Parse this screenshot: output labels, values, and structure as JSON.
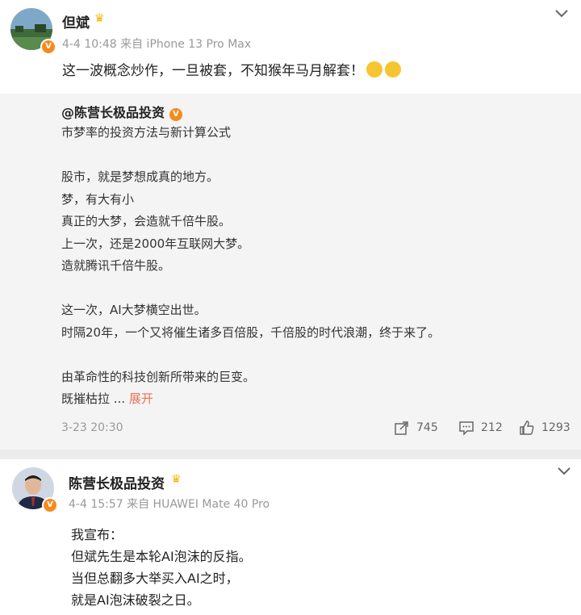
{
  "post1": {
    "author": "但斌",
    "meta": "4-4 10:48  来自 iPhone 13 Pro Max",
    "text": "这一波概念炒作，一旦被套，不知猴年马月解套！"
  },
  "repost": {
    "author": "@陈营长极品投资",
    "lines": [
      "市梦率的投资方法与新计算公式",
      "",
      "股市，就是梦想成真的地方。",
      "梦，有大有小",
      "真正的大梦，会造就千倍牛股。",
      "上一次，还是2000年互联网大梦。",
      "造就腾讯千倍牛股。",
      "",
      "这一次，AI大梦横空出世。",
      "时隔20年，一个又将催生诸多百倍股，千倍股的时代浪潮，终于来了。",
      "",
      "由革命性的科技创新所带来的巨变。"
    ],
    "last_line": "既摧枯拉  ...",
    "expand_label": "展开",
    "time": "3-23 20:30",
    "reposts": "745",
    "comments": "212",
    "likes": "1293"
  },
  "post2": {
    "author": "陈营长极品投资",
    "meta": "4-4 15:57  来自 HUAWEI Mate 40 Pro",
    "lines": [
      "我宣布：",
      "但斌先生是本轮AI泡沫的反指。",
      "当但总翻多大举买入AI之时，",
      "就是AI泡沫破裂之日。"
    ]
  },
  "colors": {
    "accent": "#eb7350",
    "badge": "#f78a1d",
    "crown": "#f6b400",
    "muted": "#999999"
  }
}
